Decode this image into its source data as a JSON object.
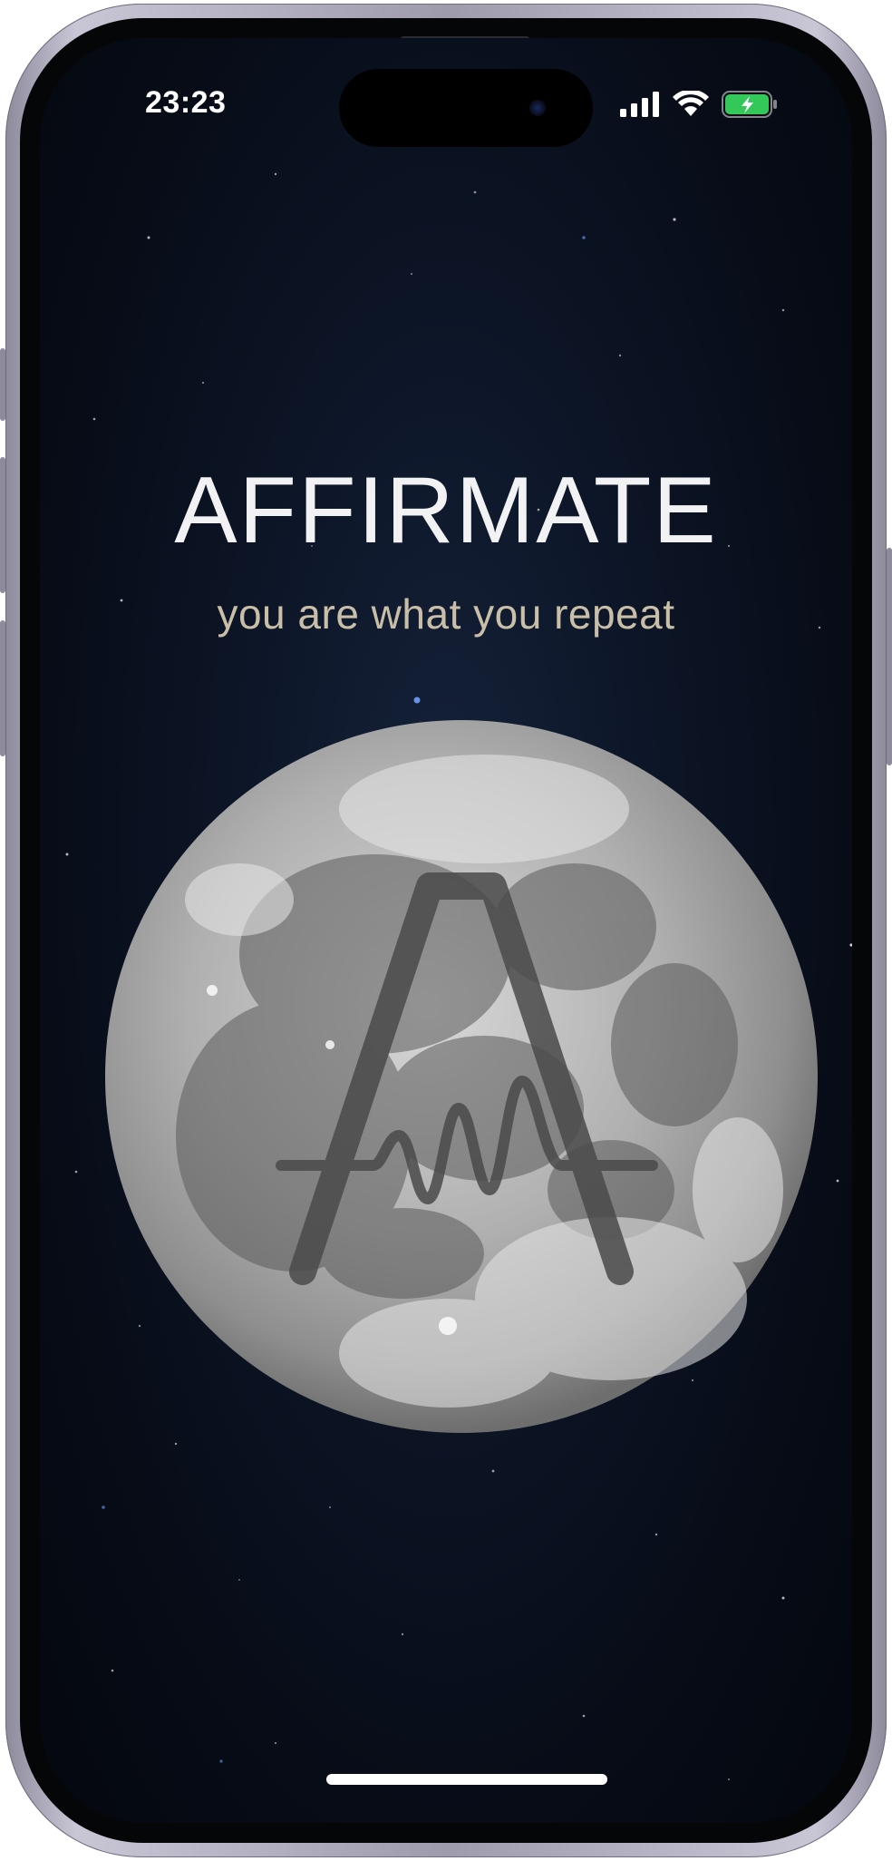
{
  "status_bar": {
    "time": "23:23",
    "signal_icon": "cellular-signal-icon",
    "wifi_icon": "wifi-icon",
    "battery_icon": "battery-charging-icon",
    "battery_color": "#34c759"
  },
  "splash": {
    "title": "AFFIRMATE",
    "tagline": "you are what you repeat",
    "logo_icon": "affirmate-logo-icon",
    "moon_image": "moon-image"
  },
  "colors": {
    "background": "#0b1324",
    "title": "#f2f2f4",
    "tagline": "#c9bfa8"
  }
}
